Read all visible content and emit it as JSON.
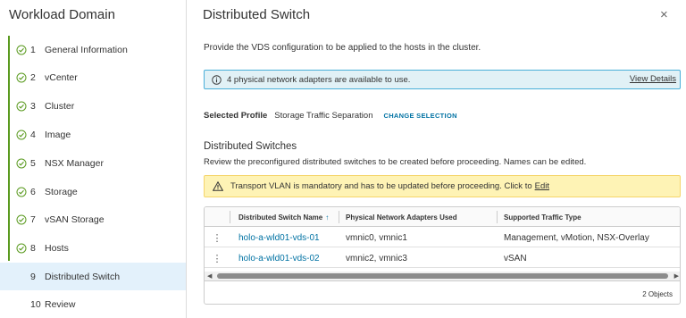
{
  "wizard": {
    "title": "Workload Domain",
    "steps": [
      {
        "num": "1",
        "label": "General Information",
        "done": true
      },
      {
        "num": "2",
        "label": "vCenter",
        "done": true
      },
      {
        "num": "3",
        "label": "Cluster",
        "done": true
      },
      {
        "num": "4",
        "label": "Image",
        "done": true
      },
      {
        "num": "5",
        "label": "NSX Manager",
        "done": true
      },
      {
        "num": "6",
        "label": "Storage",
        "done": true
      },
      {
        "num": "7",
        "label": "vSAN Storage",
        "done": true
      },
      {
        "num": "8",
        "label": "Hosts",
        "done": true
      },
      {
        "num": "9",
        "label": "Distributed Switch",
        "done": false,
        "active": true
      },
      {
        "num": "10",
        "label": "Review",
        "done": false
      }
    ]
  },
  "main": {
    "title": "Distributed Switch",
    "close_glyph": "×",
    "intro": "Provide the VDS configuration to be applied to the hosts in the cluster.",
    "info": {
      "text": "4 physical network adapters are available to use.",
      "link": "View Details"
    },
    "profile": {
      "label": "Selected Profile",
      "value": "Storage Traffic Separation",
      "change": "CHANGE SELECTION"
    },
    "section_title": "Distributed Switches",
    "section_desc": "Review the preconfigured distributed switches to be created before proceeding. Names can be edited.",
    "warning": {
      "text": "Transport VLAN is mandatory and has to be updated before proceeding. Click to",
      "link": "Edit"
    },
    "grid": {
      "columns": [
        "Distributed Switch Name",
        "Physical Network Adapters Used",
        "Supported Traffic Type"
      ],
      "sort_glyph": "↑",
      "rows": [
        {
          "name": "holo-a-wld01-vds-01",
          "adapters": "vmnic0, vmnic1",
          "traffic": "Management, vMotion, NSX-Overlay"
        },
        {
          "name": "holo-a-wld01-vds-02",
          "adapters": "vmnic2, vmnic3",
          "traffic": "vSAN"
        }
      ],
      "footer": "2 Objects"
    }
  },
  "colors": {
    "accent_link": "#0072a3",
    "success_green": "#5a9a1f",
    "info_border": "#49afd9",
    "warning_bg": "#fef3b5",
    "active_step_bg": "#e3f1fb"
  },
  "icons": {
    "step_done": "check-circle-icon",
    "info": "info-circle-icon",
    "warning": "warning-triangle-icon",
    "row_actions": "kebab-vertical-icon",
    "close": "close-icon"
  }
}
